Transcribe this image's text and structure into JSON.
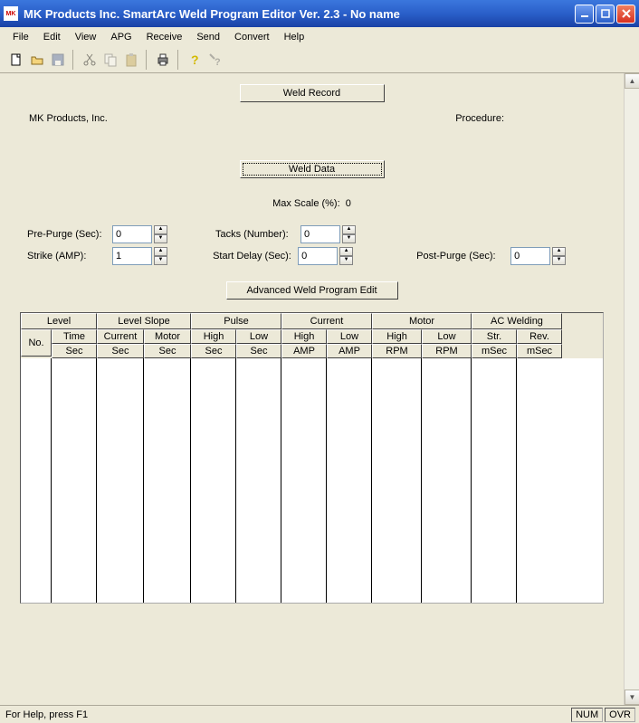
{
  "titlebar": {
    "app_icon_text": "MK",
    "title": "MK Products Inc.   SmartArc Weld Program Editor Ver. 2.3 - No name"
  },
  "menu": [
    "File",
    "Edit",
    "View",
    "APG",
    "Receive",
    "Send",
    "Convert",
    "Help"
  ],
  "toolbar": {
    "new": "new-file-icon",
    "open": "open-folder-icon",
    "save": "save-icon",
    "cut": "cut-icon",
    "copy": "copy-icon",
    "paste": "paste-icon",
    "print": "print-icon",
    "help": "help-icon",
    "context": "context-help-icon"
  },
  "buttons": {
    "weld_record": "Weld Record",
    "weld_data": "Weld Data",
    "advanced": "Advanced Weld Program Edit"
  },
  "labels": {
    "company": "MK Products, Inc.",
    "procedure": "Procedure:",
    "max_scale": "Max Scale (%):",
    "pre_purge": "Pre-Purge (Sec):",
    "strike": "Strike (AMP):",
    "tacks": "Tacks (Number):",
    "start_delay": "Start Delay (Sec):",
    "post_purge": "Post-Purge (Sec):"
  },
  "values": {
    "max_scale": "0",
    "pre_purge": "0",
    "strike": "1",
    "tacks": "0",
    "start_delay": "0",
    "post_purge": "0"
  },
  "table": {
    "groups": [
      {
        "label": "Level",
        "w": 84
      },
      {
        "label": "Level Slope",
        "w": 104
      },
      {
        "label": "Pulse",
        "w": 100
      },
      {
        "label": "Current",
        "w": 100
      },
      {
        "label": "Motor",
        "w": 110
      },
      {
        "label": "AC Welding",
        "w": 100
      }
    ],
    "cols": [
      {
        "top": "No.",
        "bot": "",
        "w": 34
      },
      {
        "top": "Time",
        "bot": "Sec",
        "w": 50
      },
      {
        "top": "Current",
        "bot": "Sec",
        "w": 52
      },
      {
        "top": "Motor",
        "bot": "Sec",
        "w": 52
      },
      {
        "top": "High",
        "bot": "Sec",
        "w": 50
      },
      {
        "top": "Low",
        "bot": "Sec",
        "w": 50
      },
      {
        "top": "High",
        "bot": "AMP",
        "w": 50
      },
      {
        "top": "Low",
        "bot": "AMP",
        "w": 50
      },
      {
        "top": "High",
        "bot": "RPM",
        "w": 55
      },
      {
        "top": "Low",
        "bot": "RPM",
        "w": 55
      },
      {
        "top": "Str.",
        "bot": "mSec",
        "w": 50
      },
      {
        "top": "Rev.",
        "bot": "mSec",
        "w": 50
      }
    ]
  },
  "status": {
    "message": "For Help, press F1",
    "num": "NUM",
    "ovr": "OVR"
  }
}
